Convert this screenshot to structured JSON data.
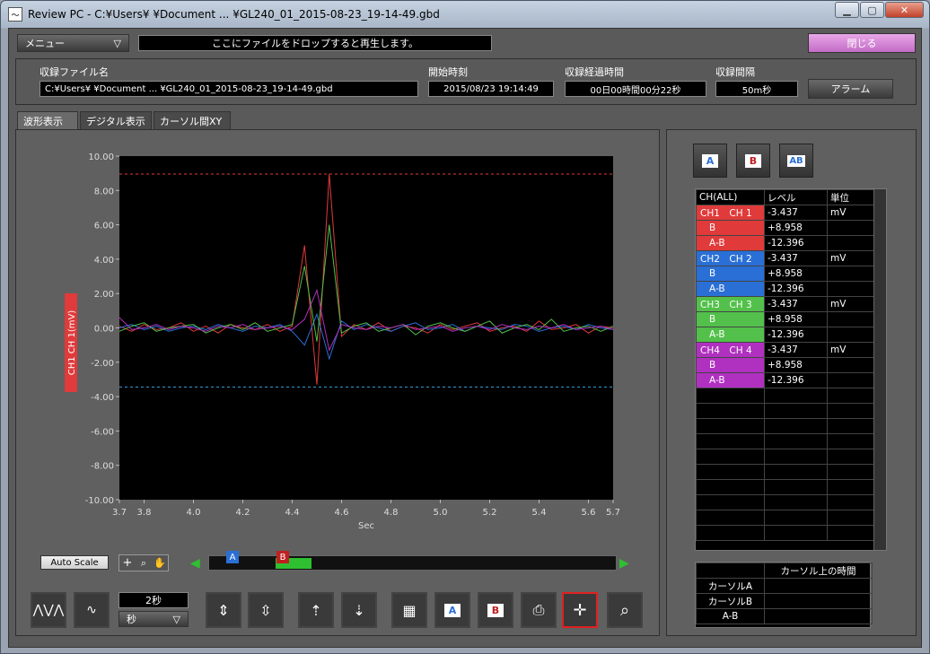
{
  "window": {
    "title": "Review PC - C:¥Users¥          ¥Document ... ¥GL240_01_2015-08-23_19-14-49.gbd",
    "min": "▁",
    "max": "▢",
    "close": "✕"
  },
  "top": {
    "menu": "メニュー",
    "drop_hint": "ここにファイルをドロップすると再生します。",
    "close_label": "閉じる"
  },
  "info": {
    "file_label": "収録ファイル名",
    "file_value": "C:¥Users¥          ¥Document ... ¥GL240_01_2015-08-23_19-14-49.gbd",
    "start_label": "開始時刻",
    "start_value": "2015/08/23 19:14:49",
    "elapsed_label": "収録経過時間",
    "elapsed_value": "00日00時間00分22秒",
    "interval_label": "収録間隔",
    "interval_value": "50m秒",
    "alarm": "アラーム"
  },
  "tabs": [
    "波形表示",
    "デジタル表示",
    "カーソル間XY"
  ],
  "chart_data": {
    "type": "line",
    "ylabel": "CH1 CH 1(mV)",
    "xlabel": "Sec",
    "ylim": [
      -10,
      10
    ],
    "xlim": [
      3.7,
      5.7
    ],
    "yticks": [
      "10.00",
      "8.00",
      "6.00",
      "4.00",
      "2.00",
      "0.00",
      "-2.00",
      "-4.00",
      "-6.00",
      "-8.00",
      "-10.00"
    ],
    "xticks": [
      "3.7",
      "3.8",
      "4.0",
      "4.2",
      "4.4",
      "4.6",
      "4.8",
      "5.0",
      "5.2",
      "5.4",
      "5.6",
      "5.7"
    ],
    "xtick_values": [
      3.7,
      3.8,
      4.0,
      4.2,
      4.4,
      4.6,
      4.8,
      5.0,
      5.2,
      5.4,
      5.6,
      5.7
    ],
    "cursor_a": -3.437,
    "cursor_b": 8.958,
    "x": [
      3.7,
      3.75,
      3.8,
      3.85,
      3.9,
      3.95,
      4.0,
      4.05,
      4.1,
      4.15,
      4.2,
      4.25,
      4.3,
      4.35,
      4.4,
      4.45,
      4.5,
      4.55,
      4.6,
      4.65,
      4.7,
      4.75,
      4.8,
      4.85,
      4.9,
      4.95,
      5.0,
      5.05,
      5.1,
      5.15,
      5.2,
      5.25,
      5.3,
      5.35,
      5.4,
      5.45,
      5.5,
      5.55,
      5.6,
      5.65,
      5.7
    ],
    "series": [
      {
        "name": "CH1",
        "color": "#e03a3a",
        "values": [
          0.1,
          -0.2,
          0.2,
          -0.1,
          0.0,
          0.3,
          -0.2,
          0.1,
          -0.3,
          0.2,
          0.0,
          -0.1,
          0.2,
          -0.2,
          0.1,
          4.8,
          -3.3,
          8.96,
          -0.5,
          0.2,
          -0.1,
          0.3,
          -0.2,
          0.1,
          0.0,
          -0.3,
          0.2,
          -0.1,
          0.1,
          0.3,
          -0.2,
          0.0,
          0.1,
          -0.2,
          0.4,
          -0.1,
          0.0,
          0.2,
          -0.3,
          0.1,
          0.0
        ]
      },
      {
        "name": "CH2",
        "color": "#2a6fd6",
        "values": [
          0.0,
          0.2,
          -0.1,
          0.1,
          -0.2,
          0.0,
          0.1,
          -0.1,
          0.2,
          0.0,
          -0.2,
          0.1,
          0.0,
          0.2,
          -0.2,
          -1.0,
          0.8,
          -1.8,
          0.4,
          -0.1,
          0.2,
          0.0,
          -0.2,
          0.1,
          0.3,
          -0.1,
          0.0,
          0.2,
          -0.2,
          0.1,
          0.0,
          -0.1,
          0.2,
          0.1,
          -0.2,
          0.0,
          0.1,
          -0.1,
          0.2,
          0.0,
          -0.1
        ]
      },
      {
        "name": "CH3",
        "color": "#52c04a",
        "values": [
          -0.2,
          0.1,
          0.3,
          -0.2,
          0.0,
          0.1,
          0.2,
          -0.3,
          0.0,
          0.2,
          -0.1,
          0.3,
          -0.2,
          0.0,
          0.2,
          3.6,
          -0.8,
          6.0,
          -0.3,
          0.1,
          0.3,
          -0.2,
          0.0,
          0.2,
          -0.4,
          0.1,
          0.3,
          0.0,
          -0.2,
          0.1,
          0.4,
          -0.3,
          0.0,
          0.2,
          -0.1,
          0.5,
          -0.2,
          0.0,
          0.1,
          -0.2,
          0.1
        ]
      },
      {
        "name": "CH4",
        "color": "#b030c0",
        "values": [
          0.6,
          -0.1,
          0.0,
          0.2,
          -0.1,
          0.1,
          0.0,
          -0.2,
          0.1,
          0.0,
          0.2,
          -0.1,
          0.0,
          0.1,
          -0.1,
          0.5,
          2.2,
          -1.3,
          0.2,
          0.0,
          -0.1,
          0.1,
          0.0,
          0.2,
          -0.1,
          0.0,
          0.1,
          -0.2,
          0.0,
          0.1,
          -0.1,
          0.2,
          0.0,
          -0.1,
          0.1,
          0.0,
          0.2,
          -0.1,
          0.0,
          0.1,
          -0.1
        ]
      }
    ]
  },
  "controls": {
    "autoscale": "Auto Scale",
    "time_value": "2秒",
    "time_unit": "秒",
    "marker_a": "A",
    "marker_b": "B"
  },
  "table": {
    "headers": [
      "CH(ALL)",
      "レベル",
      "単位"
    ],
    "rows": [
      {
        "ch": "CH1　CH 1",
        "level": "-3.437",
        "unit": "mV",
        "color": "#e03a3a"
      },
      {
        "ch": "B",
        "level": "+8.958",
        "unit": "",
        "color": "#e03a3a"
      },
      {
        "ch": "A-B",
        "level": "-12.396",
        "unit": "",
        "color": "#e03a3a"
      },
      {
        "ch": "CH2　CH 2",
        "level": "-3.437",
        "unit": "mV",
        "color": "#2a6fd6"
      },
      {
        "ch": "B",
        "level": "+8.958",
        "unit": "",
        "color": "#2a6fd6"
      },
      {
        "ch": "A-B",
        "level": "-12.396",
        "unit": "",
        "color": "#2a6fd6"
      },
      {
        "ch": "CH3　CH 3",
        "level": "-3.437",
        "unit": "mV",
        "color": "#52c04a"
      },
      {
        "ch": "B",
        "level": "+8.958",
        "unit": "",
        "color": "#52c04a"
      },
      {
        "ch": "A-B",
        "level": "-12.396",
        "unit": "",
        "color": "#52c04a"
      },
      {
        "ch": "CH4　CH 4",
        "level": "-3.437",
        "unit": "mV",
        "color": "#b030c0"
      },
      {
        "ch": "B",
        "level": "+8.958",
        "unit": "",
        "color": "#b030c0"
      },
      {
        "ch": "A-B",
        "level": "-12.396",
        "unit": "",
        "color": "#b030c0"
      }
    ]
  },
  "cursor_time": {
    "header": "カーソル上の時間",
    "rows": [
      "カーソルA",
      "カーソルB",
      "A-B"
    ]
  }
}
